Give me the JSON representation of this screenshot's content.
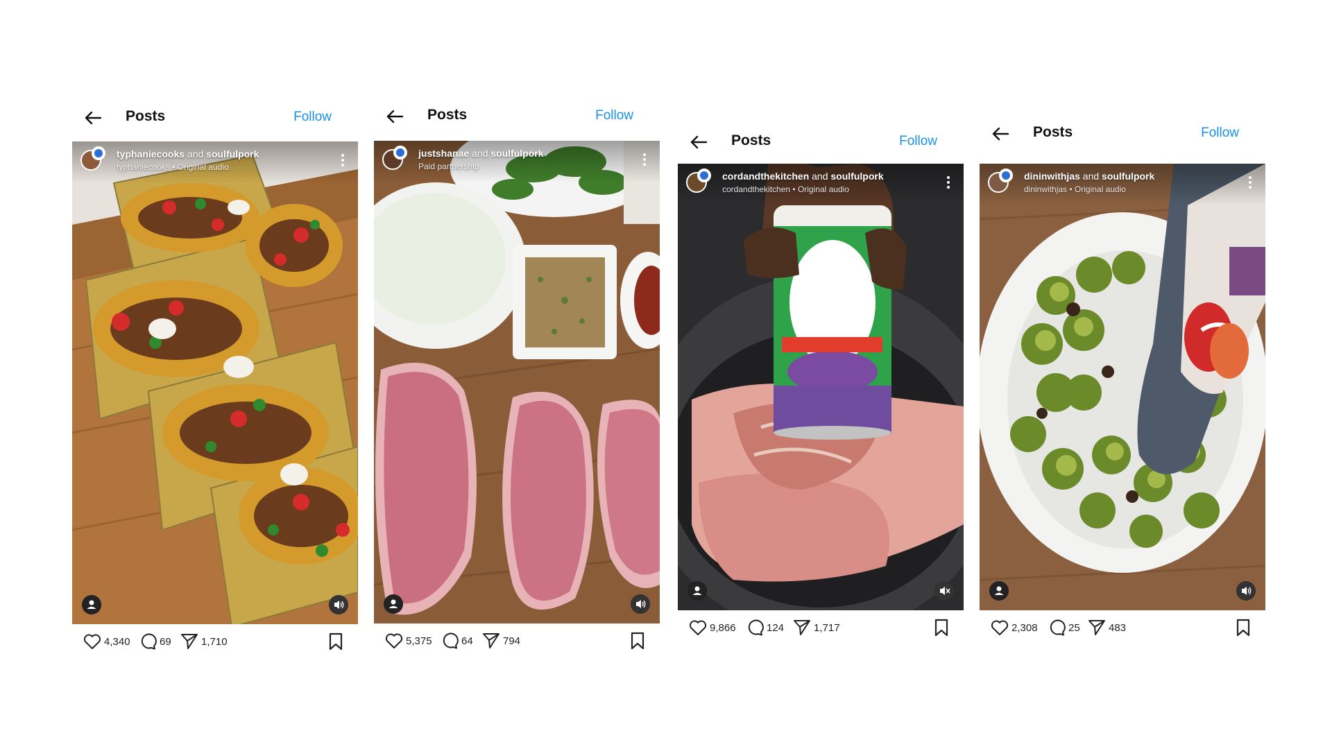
{
  "posts": [
    {
      "header_title": "Posts",
      "follow_label": "Follow",
      "author": "typhaniecooks",
      "connector": "and",
      "coauthor": "soulfulpork",
      "subline": "typhaniecooks • Original audio",
      "scene": "tacos",
      "likes": "4,340",
      "comments": "69",
      "shares": "1,710",
      "sound": "on"
    },
    {
      "header_title": "Posts",
      "follow_label": "Follow",
      "author": "justshanae",
      "connector": "and",
      "coauthor": "soulfulpork",
      "subline": "Paid partnership",
      "scene": "raw-pork-chops",
      "likes": "5,375",
      "comments": "64",
      "shares": "794",
      "sound": "on"
    },
    {
      "header_title": "Posts",
      "follow_label": "Follow",
      "author": "cordandthekitchen",
      "connector": "and",
      "coauthor": "soulfulpork",
      "subline": "cordandthekitchen • Original audio",
      "scene": "seasoning-pork",
      "likes": "9,866",
      "comments": "124",
      "shares": "1,717",
      "sound": "muted"
    },
    {
      "header_title": "Posts",
      "follow_label": "Follow",
      "author": "dininwithjas",
      "connector": "and",
      "coauthor": "soulfulpork",
      "subline": "dininwithjas • Original audio",
      "scene": "brussels-sprouts",
      "likes": "2,308",
      "comments": "25",
      "shares": "483",
      "sound": "on"
    }
  ],
  "icons": {
    "back": "arrow-left-icon",
    "like": "heart-icon",
    "comment": "comment-bubble-icon",
    "share": "paper-plane-icon",
    "save": "bookmark-icon",
    "tag": "user-tag-icon",
    "sound": "speaker-icon",
    "more": "more-vertical-icon"
  },
  "colors": {
    "follow": "#1a8fe3",
    "background": "#ffffff"
  }
}
